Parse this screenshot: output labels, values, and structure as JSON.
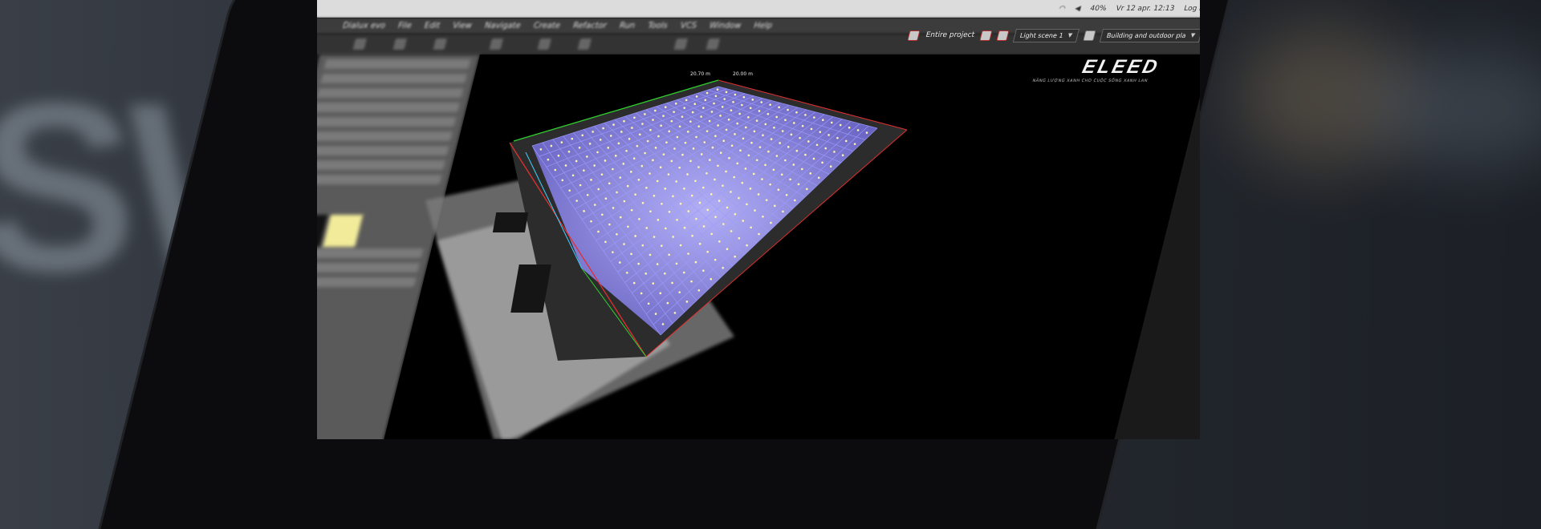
{
  "menubar": {
    "battery": "40%",
    "datetime": "Vr 12 apr.  12:13",
    "login": "Log in"
  },
  "app_menu": {
    "items": [
      "Dialux evo",
      "File",
      "Edit",
      "View",
      "Navigate",
      "Create",
      "Refactor",
      "Run",
      "Tools",
      "VCS",
      "Window",
      "Help"
    ]
  },
  "scene_bar": {
    "entire_project": "Entire project",
    "light_scene": "Light scene 1",
    "building": "Building and outdoor pla"
  },
  "viewport": {
    "logo": "ELEED",
    "logo_tagline": "NĂNG LƯỢNG XANH CHO CUỘC SỐNG XANH LAN",
    "dim_tag_1": "20.70 m",
    "dim_tag_2": "20.00 m"
  },
  "colors": {
    "grid": "#8c8cff",
    "accent_red": "#e03030",
    "accent_green": "#30d030",
    "accent_cyan": "#40d0ff"
  }
}
